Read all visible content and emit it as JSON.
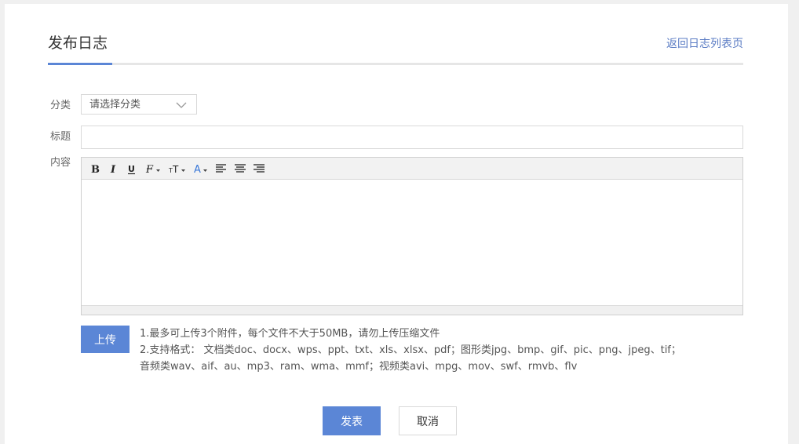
{
  "header": {
    "title": "发布日志",
    "back_link": "返回日志列表页"
  },
  "form": {
    "category_label": "分类",
    "category_value": "请选择分类",
    "title_label": "标题",
    "title_value": "",
    "content_label": "内容"
  },
  "toolbar": {
    "items": [
      {
        "name": "bold",
        "icon": "bold-icon"
      },
      {
        "name": "italic",
        "icon": "italic-icon"
      },
      {
        "name": "underline",
        "icon": "underline-icon"
      },
      {
        "name": "font-family",
        "icon": "font-family-icon"
      },
      {
        "name": "font-size",
        "icon": "font-size-icon"
      },
      {
        "name": "font-color",
        "icon": "font-color-icon"
      },
      {
        "name": "align-left",
        "icon": "align-left-icon"
      },
      {
        "name": "align-center",
        "icon": "align-center-icon"
      },
      {
        "name": "align-right",
        "icon": "align-right-icon"
      }
    ]
  },
  "upload": {
    "button_label": "上传",
    "notes": [
      "1.最多可上传3个附件，每个文件不大于50MB，请勿上传压缩文件",
      "2.支持格式： 文档类doc、docx、wps、ppt、txt、xls、xlsx、pdf；图形类jpg、bmp、gif、pic、png、jpeg、tif；",
      "音频类wav、aif、au、mp3、ram、wma、mmf；视频类avi、mpg、mov、swf、rmvb、flv"
    ]
  },
  "actions": {
    "submit_label": "发表",
    "cancel_label": "取消"
  },
  "colors": {
    "accent": "#5b86d6",
    "link": "#5b7cc4",
    "font_color_icon": "#3a78d8"
  }
}
